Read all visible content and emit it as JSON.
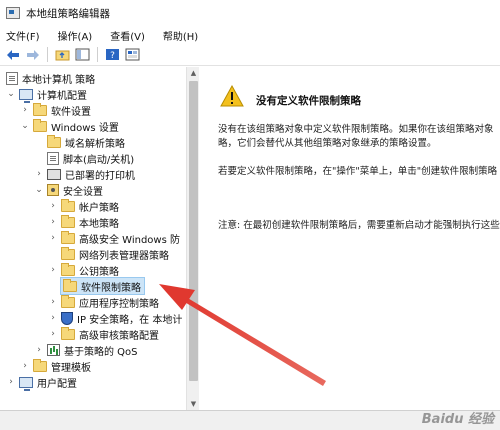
{
  "window": {
    "title": "本地组策略编辑器"
  },
  "menu": [
    "文件(F)",
    "操作(A)",
    "查看(V)",
    "帮助(H)"
  ],
  "tree": {
    "root": "本地计算机 策略",
    "computer_config": "计算机配置",
    "software_settings": "软件设置",
    "windows_settings": "Windows 设置",
    "name_resolution": "域名解析策略",
    "scripts": "脚本(启动/关机)",
    "deployed_printers": "已部署的打印机",
    "security_settings": "安全设置",
    "account_policies": "帐户策略",
    "local_policies": "本地策略",
    "advanced_firewall": "高级安全 Windows 防",
    "network_list": "网络列表管理器策略",
    "public_key": "公钥策略",
    "software_restriction": "软件限制策略",
    "app_control": "应用程序控制策略",
    "ip_security": "IP 安全策略，在 本地计",
    "advanced_audit": "高级审核策略配置",
    "qos": "基于策略的 QoS",
    "admin_templates": "管理模板",
    "user_config": "用户配置"
  },
  "content": {
    "heading": "没有定义软件限制策略",
    "para1_line1": "没有在该组策略对象中定义软件限制策略。如果你在该组策略对象",
    "para1_line2": "略，它们会替代从其他组策略对象继承的策略设置。",
    "para2": "若要定义软件限制策略，在\"操作\"菜单上，单击\"创建软件限制策略",
    "para3": "注意: 在最初创建软件限制策略后，需要重新启动才能强制执行这些"
  },
  "watermark": "Baidu 经验",
  "colors": {
    "arrow": "#e0382f",
    "selection": "#cce4f7"
  }
}
